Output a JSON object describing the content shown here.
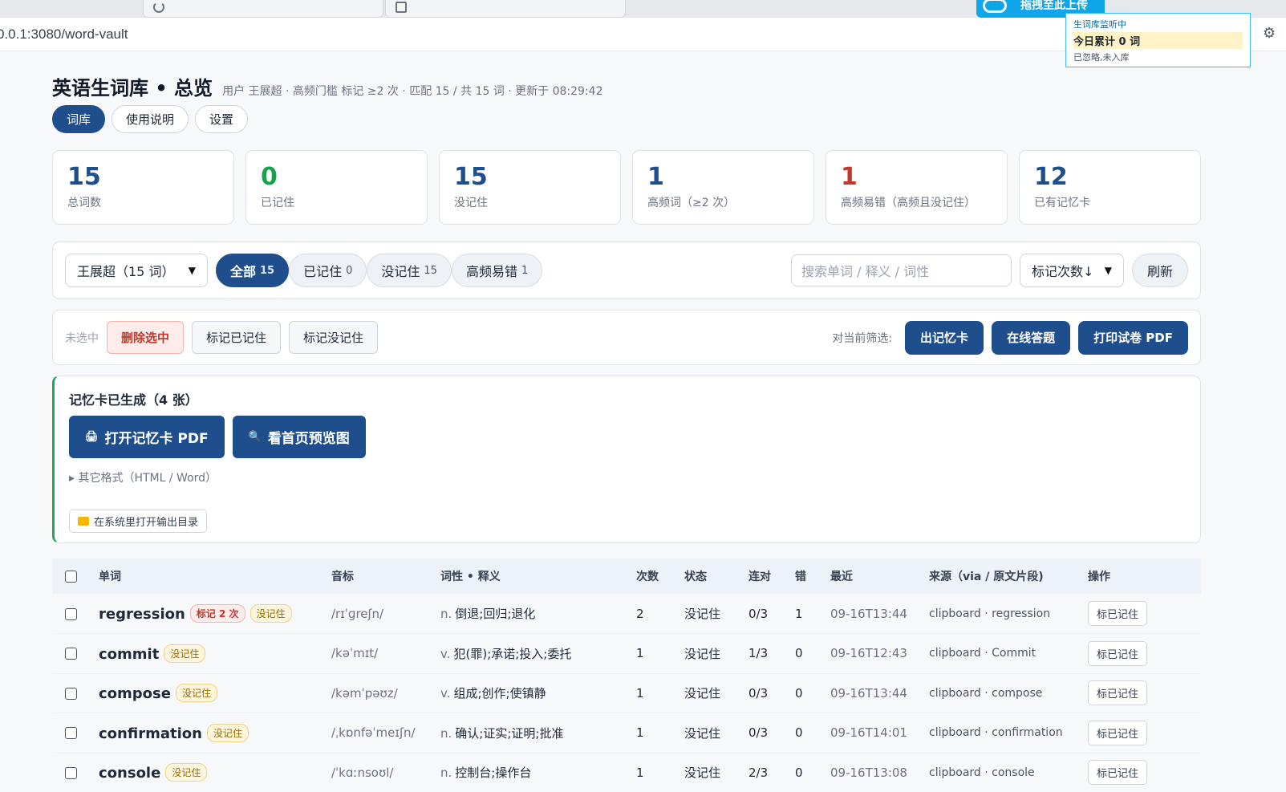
{
  "browser": {
    "url": "0.0.1:3080/word-vault",
    "upload_badge": "拖拽至此上传"
  },
  "monitor": {
    "title": "生词库监听中",
    "count": "今日累计 0 词",
    "note": "已忽略,未入库"
  },
  "header": {
    "title": "英语生词库 • 总览",
    "meta": "用户 王展超 · 高频门槛 标记 ≥2 次 · 匹配 15 / 共 15 词 · 更新于 08:29:42",
    "tabs": [
      "词库",
      "使用说明",
      "设置"
    ]
  },
  "stats": [
    {
      "value": "15",
      "label": "总词数",
      "color": "#1e4f8c"
    },
    {
      "value": "0",
      "label": "已记住",
      "color": "#16a34a"
    },
    {
      "value": "15",
      "label": "没记住",
      "color": "#1e4f8c"
    },
    {
      "value": "1",
      "label": "高频词（≥2 次）",
      "color": "#1e4f8c"
    },
    {
      "value": "1",
      "label": "高频易错（高频且没记住）",
      "color": "#c0392b"
    },
    {
      "value": "12",
      "label": "已有记忆卡",
      "color": "#1e4f8c"
    }
  ],
  "filters": {
    "user_select": "王展超（15 词）",
    "pills": [
      {
        "label": "全部",
        "count": "15"
      },
      {
        "label": "已记住",
        "count": "0"
      },
      {
        "label": "没记住",
        "count": "15"
      },
      {
        "label": "高频易错",
        "count": "1"
      }
    ],
    "search_placeholder": "搜索单词 / 释义 / 词性",
    "sort_select": "标记次数↓",
    "refresh": "刷新"
  },
  "actions": {
    "selection_status": "未选中",
    "delete": "删除选中",
    "mark_remembered": "标记已记住",
    "mark_forgotten": "标记没记住",
    "scope_label": "对当前筛选:",
    "make_cards": "出记忆卡",
    "online_quiz": "在线答题",
    "print_pdf": "打印试卷 PDF"
  },
  "card_notice": {
    "title": "记忆卡已生成（4 张）",
    "open_pdf": "打开记忆卡 PDF",
    "preview": "看首页预览图",
    "other_formats": "▸ 其它格式（HTML / Word）",
    "open_folder": "在系统里打开输出目录"
  },
  "table": {
    "headers": [
      "单词",
      "音标",
      "词性 • 释义",
      "次数",
      "状态",
      "连对",
      "错",
      "最近",
      "来源（via / 原文片段)",
      "操作"
    ],
    "rows": [
      {
        "word": "regression",
        "tags": [
          "标记 2 次",
          "没记住"
        ],
        "phonetic": "/rɪˈɡreʃn/",
        "pos": "n.",
        "meaning": "倒退;回归;退化",
        "count": "2",
        "status": "没记住",
        "streak": "0/3",
        "wrong": "1",
        "recent": "09-16T13:44",
        "source": "clipboard · regression",
        "action": "标已记住"
      },
      {
        "word": "commit",
        "tags": [
          "没记住"
        ],
        "phonetic": "/kəˈmɪt/",
        "pos": "v.",
        "meaning": "犯(罪);承诺;投入;委托",
        "count": "1",
        "status": "没记住",
        "streak": "1/3",
        "wrong": "0",
        "recent": "09-16T12:43",
        "source": "clipboard · Commit",
        "action": "标已记住"
      },
      {
        "word": "compose",
        "tags": [
          "没记住"
        ],
        "phonetic": "/kəmˈpəʊz/",
        "pos": "v.",
        "meaning": "组成;创作;使镇静",
        "count": "1",
        "status": "没记住",
        "streak": "0/3",
        "wrong": "0",
        "recent": "09-16T13:44",
        "source": "clipboard · compose",
        "action": "标已记住"
      },
      {
        "word": "confirmation",
        "tags": [
          "没记住"
        ],
        "phonetic": "/ˌkɒnfəˈmeɪʃn/",
        "pos": "n.",
        "meaning": "确认;证实;证明;批准",
        "count": "1",
        "status": "没记住",
        "streak": "0/3",
        "wrong": "0",
        "recent": "09-16T14:01",
        "source": "clipboard · confirmation",
        "action": "标已记住"
      },
      {
        "word": "console",
        "tags": [
          "没记住"
        ],
        "phonetic": "/ˈkɑːnsoʊl/",
        "pos": "n.",
        "meaning": "控制台;操作台",
        "count": "1",
        "status": "没记住",
        "streak": "2/3",
        "wrong": "0",
        "recent": "09-16T13:08",
        "source": "clipboard · console",
        "action": "标已记住"
      }
    ]
  }
}
